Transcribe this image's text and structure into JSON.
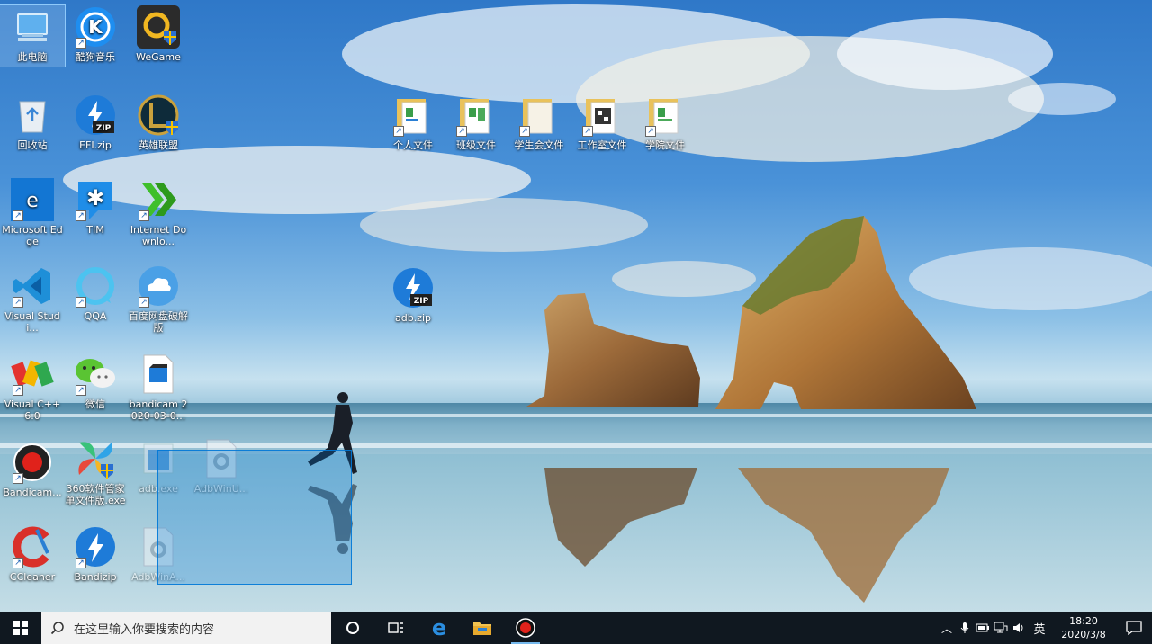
{
  "desktop_icons": {
    "this_pc": "此电脑",
    "kugou": "酷狗音乐",
    "wegame": "WeGame",
    "recycle_bin": "回收站",
    "efi_zip": "EFI.zip",
    "lol": "英雄联盟",
    "edge": "Microsoft Edge",
    "tim": "TIM",
    "idm": "Internet Downlo...",
    "vscode": "Visual Studi...",
    "qqa": "QQA",
    "baidu_netdisk": "百度网盘破解版",
    "vcpp": "Visual C++ 6.0",
    "wechat": "微信",
    "bandicam_file": "bandicam 2020-03-0...",
    "bandicam_app": "Bandicam...",
    "soft_360": "360软件管家单文件版.exe",
    "adb_exe": "adb.exe",
    "adbwinu": "AdbWinU...",
    "ccleaner": "CCleaner",
    "bandizip": "Bandizip",
    "adbwina": "AdbWinA...",
    "folder_personal": "个人文件",
    "folder_class": "班级文件",
    "folder_student_union": "学生会文件",
    "folder_studio": "工作室文件",
    "folder_college": "学院文件",
    "adb_zip": "adb.zip"
  },
  "taskbar": {
    "search_placeholder": "在这里输入你要搜索的内容",
    "ime": "英",
    "time": "18:20",
    "date": "2020/3/8"
  },
  "colors": {
    "taskbar_bg": "#101820",
    "selection": "#0078d7",
    "zip_blue": "#1e7bd8"
  }
}
